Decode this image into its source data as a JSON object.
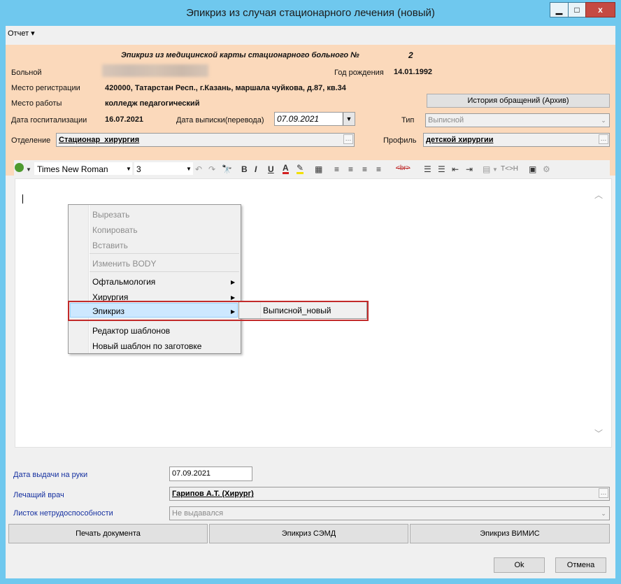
{
  "window": {
    "title": "Эпикриз из случая стационарного лечения (новый)",
    "min_label": "▁",
    "max_label": "□",
    "close_label": "x"
  },
  "menu": {
    "report_label": "Отчет ▾"
  },
  "header": {
    "title": "Эпикриз из медицинской карты стационарного больного №",
    "number": "2",
    "patient_label": "Больной",
    "birth_label": "Год рождения",
    "birth_value": "14.01.1992",
    "reg_label": "Место регистрации",
    "reg_value": "420000, Татарстан Респ., г.Казань, маршала чуйкова, д.87, кв.34",
    "work_label": "Место работы",
    "work_value": "колледж педагогический",
    "history_button": "История обращений (Архив)",
    "hosp_label": "Дата госпитализации",
    "hosp_value": "16.07.2021",
    "discharge_label": "Дата выписки(перевода)",
    "discharge_value": "07.09.2021",
    "type_label": "Тип",
    "type_value": "Выписной",
    "dept_label": "Отделение",
    "dept_value": "Стационар_хирургия",
    "profile_label": "Профиль",
    "profile_value": "детской хирургии"
  },
  "toolbar": {
    "font": "Times New Roman",
    "size": "3",
    "bold": "B",
    "italic": "I",
    "underline": "U",
    "text_color": "A",
    "br_label": "<br>",
    "tag_label": "T<>H"
  },
  "context_menu": {
    "items": [
      "Вырезать",
      "Копировать",
      "Вставить",
      "Изменить BODY",
      "Офтальмология",
      "Хирургия",
      "Эпикриз",
      "Редактор шаблонов",
      "Новый шаблон по заготовке"
    ],
    "submenu_item": "Выписной_новый"
  },
  "footer": {
    "issue_label": "Дата выдачи на руки",
    "issue_value": "07.09.2021",
    "doctor_label": "Лечащий врач",
    "doctor_value": "Гарипов А.Т. (Хирург)",
    "sick_label": "Листок нетрудоспособности",
    "sick_value": "Не выдавался",
    "print_button": "Печать документа",
    "semd_button": "Эпикриз СЭМД",
    "vimis_button": "Эпикриз ВИМИС",
    "ok_button": "Ok",
    "cancel_button": "Отмена"
  },
  "colors": {
    "title_bar": "#6fc8ee",
    "header_panel": "#fbd9bb",
    "highlight": "#cde8ff",
    "red_frame": "#c22a2a",
    "link_blue": "#1530a0"
  }
}
